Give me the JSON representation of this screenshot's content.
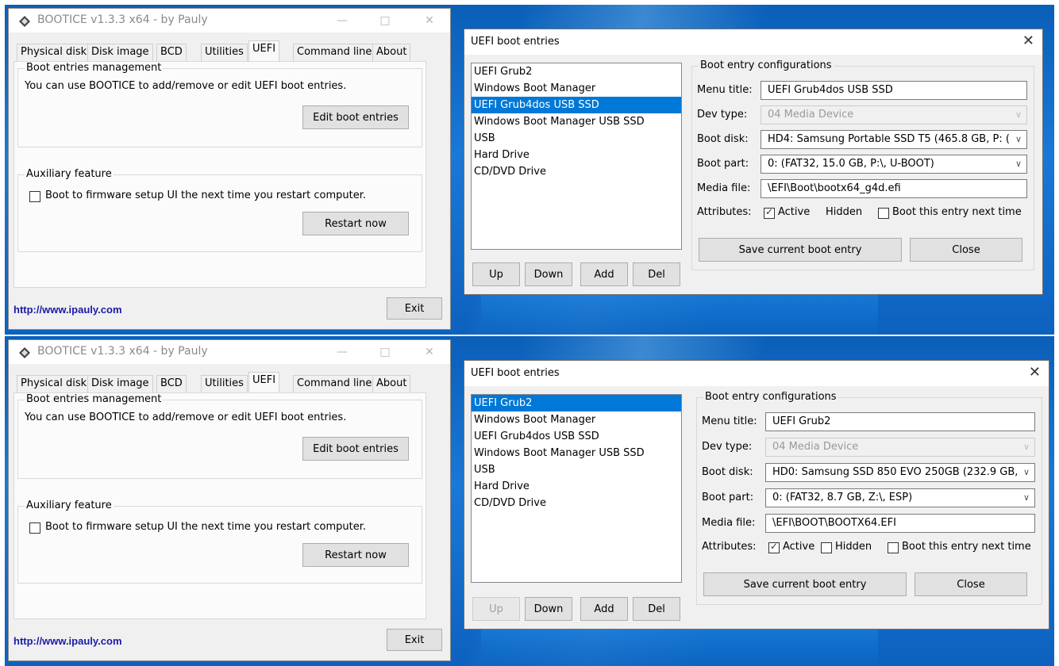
{
  "bootice": {
    "title": "BOOTICE v1.3.3 x64 - by Pauly",
    "tabs": [
      "Physical disk",
      "Disk image",
      "BCD",
      "Utilities",
      "UEFI",
      "Command line",
      "About"
    ],
    "boot_mgmt_legend": "Boot entries management",
    "boot_mgmt_desc": "You can use BOOTICE to add/remove or edit UEFI boot entries.",
    "edit_button": "Edit boot entries",
    "aux_legend": "Auxiliary feature",
    "firmware_checkbox_label": "Boot to firmware setup UI the next time you restart computer.",
    "restart_button": "Restart now",
    "link": "http://www.ipauly.com",
    "exit_button": "Exit"
  },
  "uefi_dialog": {
    "title": "UEFI boot entries",
    "close_glyph": "✕",
    "entries": [
      "UEFI Grub2",
      "Windows Boot Manager",
      "UEFI Grub4dos USB SSD",
      "Windows Boot Manager USB SSD",
      "USB",
      "Hard Drive",
      "CD/DVD Drive"
    ],
    "buttons": {
      "up": "Up",
      "down": "Down",
      "add": "Add",
      "del": "Del"
    },
    "config_legend": "Boot entry configurations",
    "labels": {
      "menu_title": "Menu title:",
      "dev_type": "Dev type:",
      "boot_disk": "Boot disk:",
      "boot_part": "Boot part:",
      "media_file": "Media file:",
      "attributes": "Attributes:"
    },
    "attr_active": "Active",
    "attr_hidden": "Hidden",
    "attr_next": "Boot this entry next time",
    "save_button": "Save current boot entry",
    "close_button": "Close"
  },
  "screens": [
    {
      "selected_index": 2,
      "up_enabled": true,
      "menu_title": "UEFI Grub4dos USB SSD",
      "dev_type": "04 Media Device",
      "boot_disk": "HD4: Samsung Portable SSD T5 (465.8 GB, P: (",
      "boot_part": "0: (FAT32,  15.0 GB, P:\\, U-BOOT)",
      "media_file": "\\EFI\\Boot\\bootx64_g4d.efi",
      "active": true,
      "hidden": false,
      "next": false
    },
    {
      "selected_index": 0,
      "up_enabled": false,
      "menu_title": "UEFI Grub2",
      "dev_type": "04 Media Device",
      "boot_disk": "HD0: Samsung SSD 850 EVO 250GB (232.9 GB,",
      "boot_part": "0: (FAT32,   8.7 GB, Z:\\, ESP)",
      "media_file": "\\EFI\\BOOT\\BOOTX64.EFI",
      "active": true,
      "hidden": false,
      "next": false
    }
  ]
}
